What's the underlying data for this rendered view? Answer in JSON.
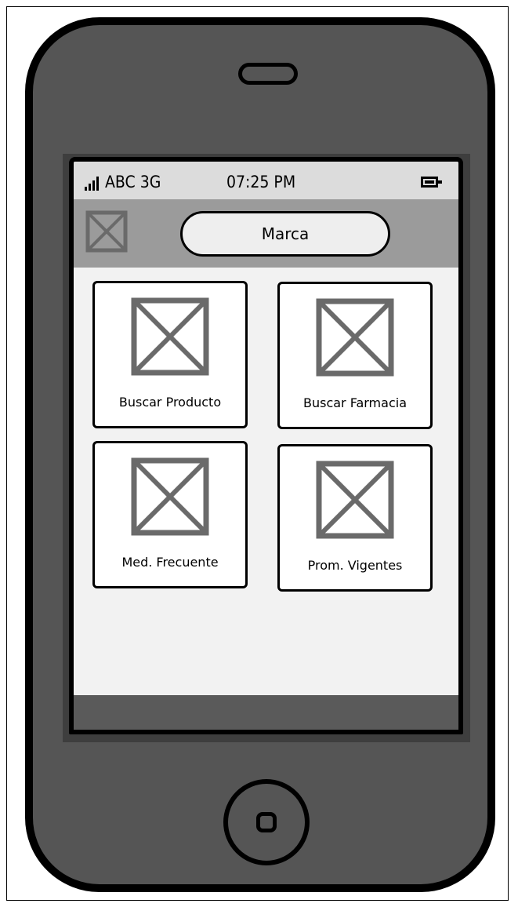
{
  "status_bar": {
    "carrier": "ABC 3G",
    "time": "07:25 PM"
  },
  "app_bar": {
    "brand": "Marca",
    "menu_icon": "image-placeholder-icon"
  },
  "tiles": [
    {
      "label": "Buscar Producto",
      "icon": "image-placeholder-icon"
    },
    {
      "label": "Buscar Farmacia",
      "icon": "image-placeholder-icon"
    },
    {
      "label": "Med. Frecuente",
      "icon": "image-placeholder-icon"
    },
    {
      "label": "Prom. Vigentes",
      "icon": "image-placeholder-icon"
    }
  ],
  "colors": {
    "phone_body": "#555555",
    "screen_bg": "#f2f2f2",
    "app_bar": "#9b9b9b",
    "placeholder_icon": "#6a6a6a"
  }
}
